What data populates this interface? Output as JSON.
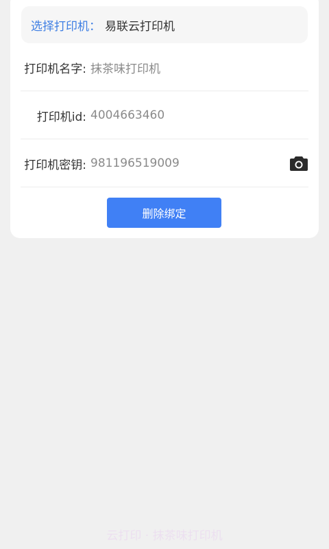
{
  "printer_select": {
    "label": "选择打印机：",
    "value": "易联云打印机"
  },
  "fields": {
    "name": {
      "label": "打印机名字:",
      "value": "抹茶味打印机"
    },
    "id": {
      "label": "打印机id:",
      "value": "4004663460"
    },
    "key": {
      "label": "打印机密钥:",
      "value": "981196519009"
    }
  },
  "icons": {
    "scan": "camera-icon"
  },
  "actions": {
    "delete_label": "删除绑定"
  },
  "colors": {
    "accent": "#4080f5",
    "link": "#3f7fe3",
    "background": "#f0f0f0"
  },
  "watermark": {
    "text": "云打印 · 抹茶味打印机"
  }
}
